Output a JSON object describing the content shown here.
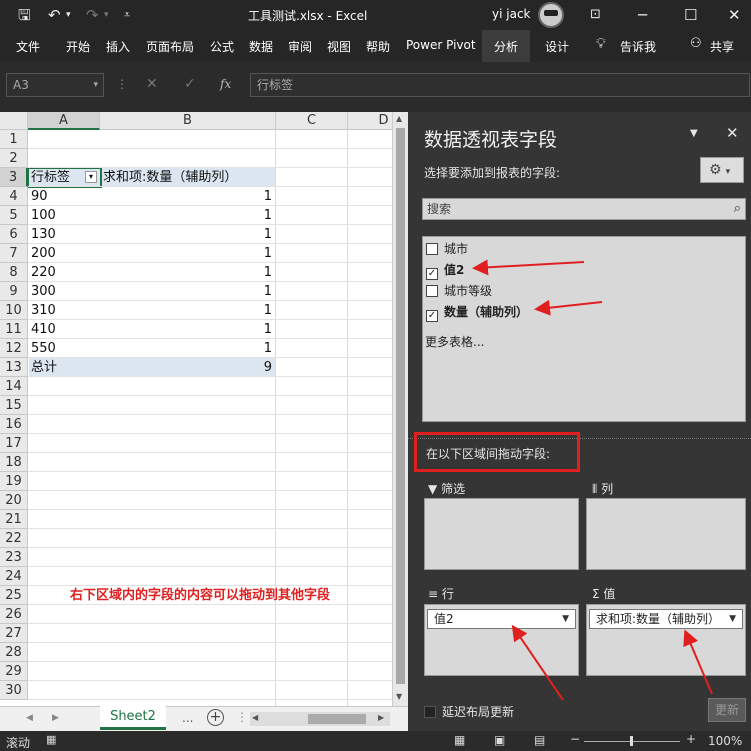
{
  "titlebar": {
    "filename": "工具测试.xlsx",
    "sep": " - ",
    "app": "Excel",
    "user": "yi jack"
  },
  "ribbon": {
    "tabs": [
      "文件",
      "开始",
      "插入",
      "页面布局",
      "公式",
      "数据",
      "审阅",
      "视图",
      "帮助",
      "Power Pivot",
      "分析",
      "设计"
    ],
    "tell_me": "告诉我",
    "share": "共享"
  },
  "formula_bar": {
    "name_box": "A3",
    "content": "行标签"
  },
  "grid": {
    "columns": [
      "A",
      "B",
      "C",
      "D"
    ],
    "rows": [
      "1",
      "2",
      "3",
      "4",
      "5",
      "6",
      "7",
      "8",
      "9",
      "10",
      "11",
      "12",
      "13",
      "14",
      "15",
      "16",
      "17",
      "18",
      "19",
      "20",
      "21",
      "22",
      "23",
      "24",
      "25",
      "26",
      "27",
      "28",
      "29",
      "30"
    ],
    "header_label": "行标签",
    "header_value": "求和项:数量（辅助列）",
    "data": [
      {
        "label": "90",
        "value": "1"
      },
      {
        "label": "100",
        "value": "1"
      },
      {
        "label": "130",
        "value": "1"
      },
      {
        "label": "200",
        "value": "1"
      },
      {
        "label": "220",
        "value": "1"
      },
      {
        "label": "300",
        "value": "1"
      },
      {
        "label": "310",
        "value": "1"
      },
      {
        "label": "410",
        "value": "1"
      },
      {
        "label": "550",
        "value": "1"
      }
    ],
    "total_label": "总计",
    "total_value": "9",
    "annotation": "右下区域内的字段的内容可以拖动到其他字段"
  },
  "sheets": {
    "active": "Sheet2",
    "more": "..."
  },
  "status": {
    "mode": "滚动",
    "zoom": "100%"
  },
  "panel": {
    "title": "数据透视表字段",
    "subtitle": "选择要添加到报表的字段:",
    "search_placeholder": "搜索",
    "fields": [
      {
        "name": "城市",
        "checked": false
      },
      {
        "name": "值2",
        "checked": true
      },
      {
        "name": "城市等级",
        "checked": false
      },
      {
        "name": "数量（辅助列）",
        "checked": true
      }
    ],
    "more_tables": "更多表格...",
    "drag_label": "在以下区域间拖动字段:",
    "filter_label": "筛选",
    "columns_label": "列",
    "rows_label": "行",
    "values_label": "值",
    "rows_item": "值2",
    "values_item": "求和项:数量（辅助列）",
    "defer": "延迟布局更新",
    "update": "更新"
  },
  "colors": {
    "annotation": "#e02020",
    "accent": "#217346",
    "pivot_header": "#dce6f1"
  }
}
